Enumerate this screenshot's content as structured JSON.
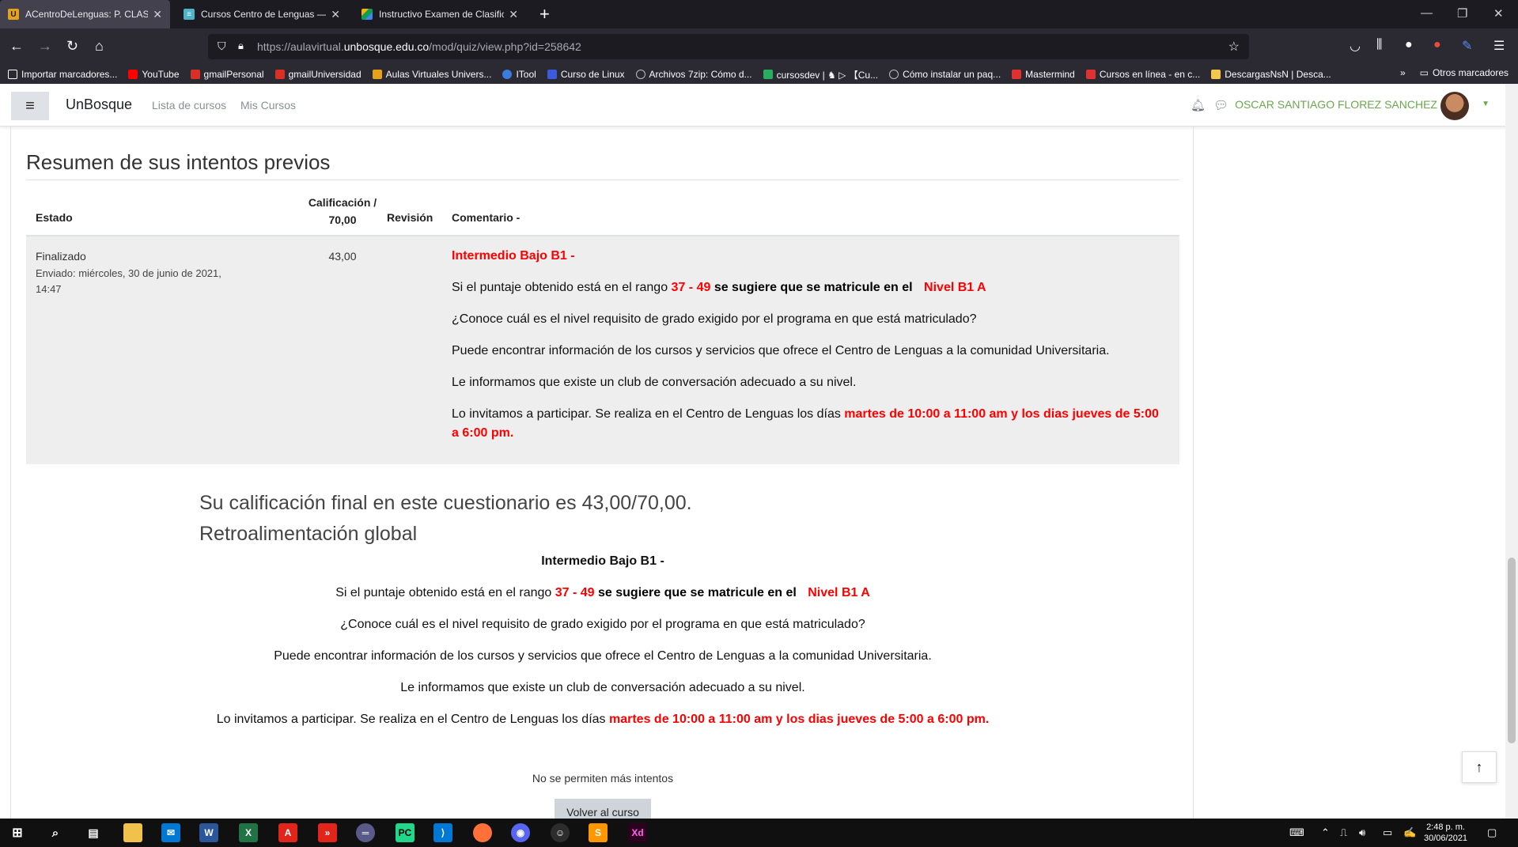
{
  "browser": {
    "tabs": [
      {
        "title": "ACentroDeLenguas: P. CLASIFIC",
        "active": true
      },
      {
        "title": "Cursos Centro de Lenguas — Fr",
        "active": false
      },
      {
        "title": "Instructivo Examen de Clasificac",
        "active": false
      }
    ],
    "new_tab_label": "+",
    "url_prefix": "https://aulavirtual.",
    "url_host": "unbosque.edu.co",
    "url_path": "/mod/quiz/view.php?id=258642",
    "bookmarks": [
      {
        "label": "Importar marcadores...",
        "color": "#fbfbfe"
      },
      {
        "label": "YouTube",
        "color": "#ff0000"
      },
      {
        "label": "gmailPersonal",
        "color": "#d93025"
      },
      {
        "label": "gmailUniversidad",
        "color": "#d93025"
      },
      {
        "label": "Aulas Virtuales Univers...",
        "color": "#e3a21a"
      },
      {
        "label": "ITool",
        "color": "#3b7ddd"
      },
      {
        "label": "Curso de Linux",
        "color": "#3b5bdb"
      },
      {
        "label": "Archivos 7zip: Cómo d...",
        "color": "#bbbbbb"
      },
      {
        "label": "cursosdev | ♞ ▷ 【Cu...",
        "color": "#27ae60"
      },
      {
        "label": "Cómo instalar un paq...",
        "color": "#bbbbbb"
      },
      {
        "label": "Mastermind",
        "color": "#e03131"
      },
      {
        "label": "Cursos en línea - en c...",
        "color": "#e03131"
      },
      {
        "label": "DescargasNsN | Desca...",
        "color": "#f2c94c"
      }
    ],
    "other_bookmarks": "Otros marcadores"
  },
  "header": {
    "brand": "UnBosque",
    "links": [
      "Lista de cursos",
      "Mis Cursos"
    ],
    "user_name": "OSCAR SANTIAGO FLOREZ SANCHEZ"
  },
  "summary": {
    "heading": "Resumen de sus intentos previos",
    "columns": {
      "estado": "Estado",
      "grade_line1": "Calificación /",
      "grade_line2": "70,00",
      "revision": "Revisión",
      "comentario": "Comentario -"
    },
    "row": {
      "estado": "Finalizado",
      "enviado_line1": "Enviado: miércoles, 30 de junio de 2021,",
      "enviado_line2": "14:47",
      "grade": "43,00"
    }
  },
  "feedback": {
    "level": "Intermedio Bajo B1 -",
    "range_prefix": "Si  el  puntaje  obtenido  está  en  el  rango",
    "range_value": "37 - 49",
    "suggest": "se sugiere que se matricule  en  el",
    "level_name": "Nivel B1 A",
    "question": "¿Conoce cuál es el nivel requisito de grado exigido por el programa en que está matriculado?",
    "info": "Puede encontrar información de los cursos y servicios que ofrece el Centro de Lenguas a la comunidad Universitaria.",
    "club": "Le informamos que existe un club de conversación adecuado a su nivel.",
    "invite": "Lo invitamos a participar. Se realiza en el Centro de Lenguas los días",
    "schedule": "martes de 10:00 a 11:00 am  y los dias jueves de 5:00 a 6:00 pm.",
    "schedule_l1": "martes de 10:00 a 11:00 am  y los dias jueves de 5:00",
    "schedule_l2": "a 6:00 pm."
  },
  "final": {
    "grade_text": "Su calificación final en este cuestionario es 43,00/70,00.",
    "global_title": "Retroalimentación global",
    "no_more": "No se permiten más intentos",
    "back_button": "Volver al curso"
  },
  "taskbar": {
    "time": "2:48 p. m.",
    "date": "30/06/2021"
  }
}
